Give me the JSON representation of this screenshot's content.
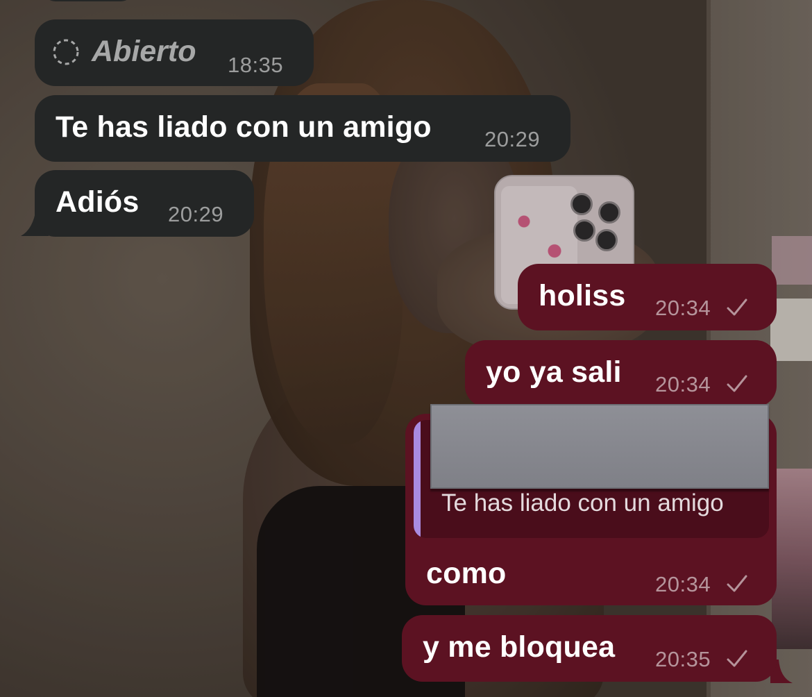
{
  "status_message": {
    "text": "Abierto",
    "time": "18:35",
    "icon": "loading-circle-icon"
  },
  "messages": [
    {
      "direction": "incoming",
      "text": "Te has liado con un amigo",
      "time": "20:29"
    },
    {
      "direction": "incoming",
      "text": "Adiós",
      "time": "20:29"
    },
    {
      "direction": "outgoing",
      "text": "holiss",
      "time": "20:34",
      "status": "sent-check-icon"
    },
    {
      "direction": "outgoing",
      "text": "yo ya sali",
      "time": "20:34",
      "status": "sent-check-icon"
    },
    {
      "direction": "outgoing",
      "text": "como",
      "time": "20:34",
      "status": "sent-check-icon",
      "reply_to": {
        "text": "Te has liado con un amigo",
        "media": "redacted"
      }
    },
    {
      "direction": "outgoing",
      "text": "y me bloquea",
      "time": "20:35",
      "status": "sent-check-icon"
    }
  ],
  "colors": {
    "incoming_bubble": "#242626",
    "outgoing_bubble": "#5c1222",
    "reply_accent": "#a98be0"
  }
}
